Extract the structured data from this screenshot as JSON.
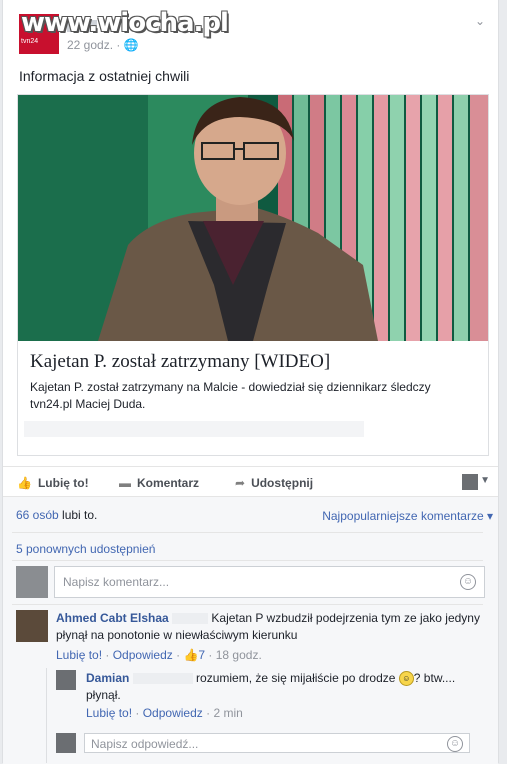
{
  "watermark": "www.wiocha.pl",
  "post": {
    "time": "22 godz. · 🌐",
    "status_text": "Informacja z ostatniej chwili",
    "link_title": "Kajetan P. został zatrzymany [WIDEO]",
    "link_desc": "Kajetan P. został zatrzymany na Malcie - dowiedział się dziennikarz śledczy tvn24.pl Maciej Duda."
  },
  "actions": {
    "like": "Lubię to!",
    "comment": "Komentarz",
    "share": "Udostępnij"
  },
  "stats": {
    "likes_count": "66 osób",
    "likes_suffix": " lubi to.",
    "sort": "Najpopularniejsze komentarze ▾",
    "shares": "5 ponownych udostępnień"
  },
  "comment_box": {
    "placeholder": "Napisz komentarz..."
  },
  "comments": [
    {
      "author": "Ahmed Cabt Elshaa",
      "text": "Kajetan P wzbudził podejrzenia tym ze jako jedyny płynął na ponotonie w niewłaściwym kierunku",
      "like": "Lubię to!",
      "reply": "Odpowiedz",
      "likes": "7",
      "time": "18 godz."
    },
    {
      "author": "Damian",
      "text_a": "rozumiem, że się mijałiście po drodze",
      "text_b": "? btw.... płynął.",
      "like": "Lubię to!",
      "reply": "Odpowiedz",
      "time": "2 min"
    }
  ],
  "reply_box": {
    "placeholder": "Napisz odpowiedź..."
  },
  "icons": {
    "chevron": "chevron-down-icon",
    "like": "thumbs-up-icon",
    "comment": "speech-bubble-icon",
    "share": "share-arrow-icon",
    "smile": "smiley-icon"
  }
}
